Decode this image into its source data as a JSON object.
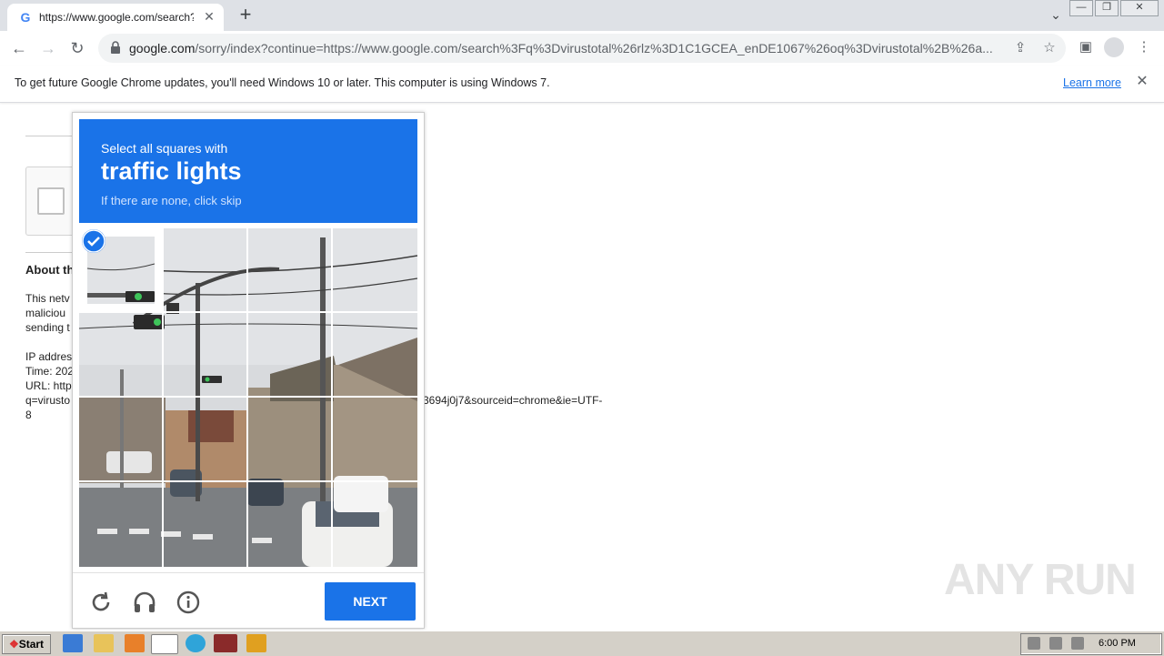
{
  "browser": {
    "tab_title": "https://www.google.com/search?q=",
    "tab_favicon": "G",
    "url_host": "google.com",
    "url_path": "/sorry/index?continue=https://www.google.com/search%3Fq%3Dvirustotal%26rlz%3D1C1GCEA_enDE1067%26oq%3Dvirustotal%2B%26a...",
    "win_minimize": "—",
    "win_restore": "❐",
    "win_close": "✕"
  },
  "infobar": {
    "message": "To get future Google Chrome updates, you'll need Windows 10 or later. This computer is using Windows 7.",
    "link": "Learn more"
  },
  "page": {
    "about_heading": "About th",
    "para1": [
      "This netv",
      "maliciou",
      "sending t"
    ],
    "para2": [
      "IP addres",
      "Time: 202",
      "URL: http",
      "q=virusto",
      "8"
    ],
    "url_tail": "3694j0j7&sourceid=chrome&ie=UTF-"
  },
  "captcha": {
    "line1": "Select all squares with",
    "line2": "traffic lights",
    "line3": "If there are none, click skip",
    "next_label": "NEXT",
    "selected_tiles": [
      0
    ]
  },
  "watermark": "ANY RUN",
  "taskbar": {
    "start_label": "Start",
    "clock": "6:00 PM"
  }
}
